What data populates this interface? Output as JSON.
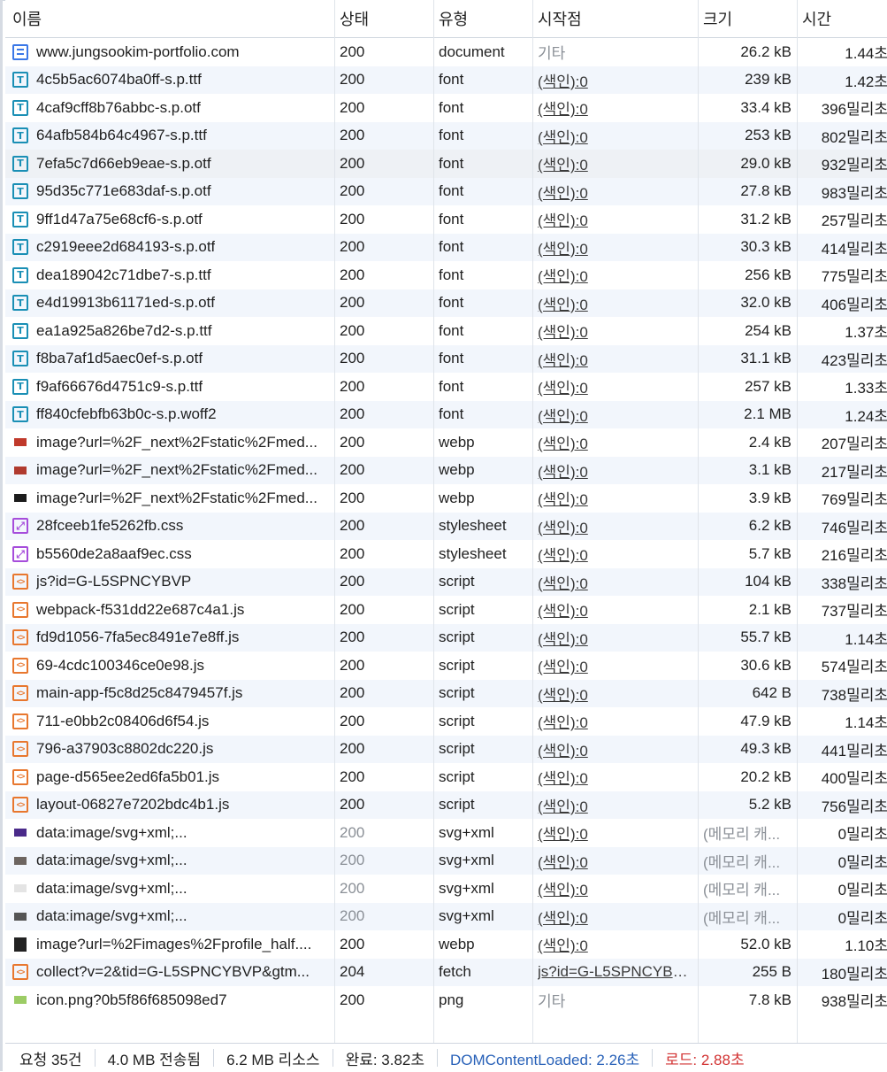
{
  "columns": {
    "name": "이름",
    "status": "상태",
    "type": "유형",
    "initiator": "시작점",
    "size": "크기",
    "time": "시간"
  },
  "rows": [
    {
      "name": "www.jungsookim-portfolio.com",
      "status": "200",
      "type": "document",
      "initiator": "기타",
      "size": "26.2 kB",
      "time": "1.44초",
      "icon": "document-icon"
    },
    {
      "name": "4c5b5ac6074ba0ff-s.p.ttf",
      "status": "200",
      "type": "font",
      "initiator": "(색인):0",
      "size": "239 kB",
      "time": "1.42초",
      "icon": "font-icon"
    },
    {
      "name": "4caf9cff8b76abbc-s.p.otf",
      "status": "200",
      "type": "font",
      "initiator": "(색인):0",
      "size": "33.4 kB",
      "time": "396밀리초",
      "icon": "font-icon"
    },
    {
      "name": "64afb584b64c4967-s.p.ttf",
      "status": "200",
      "type": "font",
      "initiator": "(색인):0",
      "size": "253 kB",
      "time": "802밀리초",
      "icon": "font-icon"
    },
    {
      "name": "7efa5c7d66eb9eae-s.p.otf",
      "status": "200",
      "type": "font",
      "initiator": "(색인):0",
      "size": "29.0 kB",
      "time": "932밀리초",
      "icon": "font-icon"
    },
    {
      "name": "95d35c771e683daf-s.p.otf",
      "status": "200",
      "type": "font",
      "initiator": "(색인):0",
      "size": "27.8 kB",
      "time": "983밀리초",
      "icon": "font-icon"
    },
    {
      "name": "9ff1d47a75e68cf6-s.p.otf",
      "status": "200",
      "type": "font",
      "initiator": "(색인):0",
      "size": "31.2 kB",
      "time": "257밀리초",
      "icon": "font-icon"
    },
    {
      "name": "c2919eee2d684193-s.p.otf",
      "status": "200",
      "type": "font",
      "initiator": "(색인):0",
      "size": "30.3 kB",
      "time": "414밀리초",
      "icon": "font-icon"
    },
    {
      "name": "dea189042c71dbe7-s.p.ttf",
      "status": "200",
      "type": "font",
      "initiator": "(색인):0",
      "size": "256 kB",
      "time": "775밀리초",
      "icon": "font-icon"
    },
    {
      "name": "e4d19913b61171ed-s.p.otf",
      "status": "200",
      "type": "font",
      "initiator": "(색인):0",
      "size": "32.0 kB",
      "time": "406밀리초",
      "icon": "font-icon"
    },
    {
      "name": "ea1a925a826be7d2-s.p.ttf",
      "status": "200",
      "type": "font",
      "initiator": "(색인):0",
      "size": "254 kB",
      "time": "1.37초",
      "icon": "font-icon"
    },
    {
      "name": "f8ba7af1d5aec0ef-s.p.otf",
      "status": "200",
      "type": "font",
      "initiator": "(색인):0",
      "size": "31.1 kB",
      "time": "423밀리초",
      "icon": "font-icon"
    },
    {
      "name": "f9af66676d4751c9-s.p.ttf",
      "status": "200",
      "type": "font",
      "initiator": "(색인):0",
      "size": "257 kB",
      "time": "1.33초",
      "icon": "font-icon"
    },
    {
      "name": "ff840cfebfb63b0c-s.p.woff2",
      "status": "200",
      "type": "font",
      "initiator": "(색인):0",
      "size": "2.1 MB",
      "time": "1.24초",
      "icon": "font-icon"
    },
    {
      "name": "image?url=%2F_next%2Fstatic%2Fmed...",
      "status": "200",
      "type": "webp",
      "initiator": "(색인):0",
      "size": "2.4 kB",
      "time": "207밀리초",
      "icon": "image-thumbnail-icon",
      "thumb": "#c0392b"
    },
    {
      "name": "image?url=%2F_next%2Fstatic%2Fmed...",
      "status": "200",
      "type": "webp",
      "initiator": "(색인):0",
      "size": "3.1 kB",
      "time": "217밀리초",
      "icon": "image-thumbnail-icon",
      "thumb": "#b03a2e"
    },
    {
      "name": "image?url=%2F_next%2Fstatic%2Fmed...",
      "status": "200",
      "type": "webp",
      "initiator": "(색인):0",
      "size": "3.9 kB",
      "time": "769밀리초",
      "icon": "image-thumbnail-icon",
      "thumb": "#1c1c1c"
    },
    {
      "name": "28fceeb1fe5262fb.css",
      "status": "200",
      "type": "stylesheet",
      "initiator": "(색인):0",
      "size": "6.2 kB",
      "time": "746밀리초",
      "icon": "stylesheet-icon"
    },
    {
      "name": "b5560de2a8aaf9ec.css",
      "status": "200",
      "type": "stylesheet",
      "initiator": "(색인):0",
      "size": "5.7 kB",
      "time": "216밀리초",
      "icon": "stylesheet-icon"
    },
    {
      "name": "js?id=G-L5SPNCYBVP",
      "status": "200",
      "type": "script",
      "initiator": "(색인):0",
      "size": "104 kB",
      "time": "338밀리초",
      "icon": "script-icon"
    },
    {
      "name": "webpack-f531dd22e687c4a1.js",
      "status": "200",
      "type": "script",
      "initiator": "(색인):0",
      "size": "2.1 kB",
      "time": "737밀리초",
      "icon": "script-icon"
    },
    {
      "name": "fd9d1056-7fa5ec8491e7e8ff.js",
      "status": "200",
      "type": "script",
      "initiator": "(색인):0",
      "size": "55.7 kB",
      "time": "1.14초",
      "icon": "script-icon"
    },
    {
      "name": "69-4cdc100346ce0e98.js",
      "status": "200",
      "type": "script",
      "initiator": "(색인):0",
      "size": "30.6 kB",
      "time": "574밀리초",
      "icon": "script-icon"
    },
    {
      "name": "main-app-f5c8d25c8479457f.js",
      "status": "200",
      "type": "script",
      "initiator": "(색인):0",
      "size": "642 B",
      "time": "738밀리초",
      "icon": "script-icon"
    },
    {
      "name": "711-e0bb2c08406d6f54.js",
      "status": "200",
      "type": "script",
      "initiator": "(색인):0",
      "size": "47.9 kB",
      "time": "1.14초",
      "icon": "script-icon"
    },
    {
      "name": "796-a37903c8802dc220.js",
      "status": "200",
      "type": "script",
      "initiator": "(색인):0",
      "size": "49.3 kB",
      "time": "441밀리초",
      "icon": "script-icon"
    },
    {
      "name": "page-d565ee2ed6fa5b01.js",
      "status": "200",
      "type": "script",
      "initiator": "(색인):0",
      "size": "20.2 kB",
      "time": "400밀리초",
      "icon": "script-icon"
    },
    {
      "name": "layout-06827e7202bdc4b1.js",
      "status": "200",
      "type": "script",
      "initiator": "(색인):0",
      "size": "5.2 kB",
      "time": "756밀리초",
      "icon": "script-icon"
    },
    {
      "name": "data:image/svg+xml;...",
      "status": "200",
      "type": "svg+xml",
      "initiator": "(색인):0",
      "size": "(메모리 캐...",
      "time": "0밀리초",
      "icon": "image-thumbnail-icon",
      "thumb": "#4a2a8a",
      "muted": true
    },
    {
      "name": "data:image/svg+xml;...",
      "status": "200",
      "type": "svg+xml",
      "initiator": "(색인):0",
      "size": "(메모리 캐...",
      "time": "0밀리초",
      "icon": "image-thumbnail-icon",
      "thumb": "#6d6560",
      "muted": true
    },
    {
      "name": "data:image/svg+xml;...",
      "status": "200",
      "type": "svg+xml",
      "initiator": "(색인):0",
      "size": "(메모리 캐...",
      "time": "0밀리초",
      "icon": "image-thumbnail-icon",
      "thumb": "#e4e4e4",
      "muted": true
    },
    {
      "name": "data:image/svg+xml;...",
      "status": "200",
      "type": "svg+xml",
      "initiator": "(색인):0",
      "size": "(메모리 캐...",
      "time": "0밀리초",
      "icon": "image-thumbnail-icon",
      "thumb": "#555555",
      "muted": true
    },
    {
      "name": "image?url=%2Fimages%2Fprofile_half....",
      "status": "200",
      "type": "webp",
      "initiator": "(색인):0",
      "size": "52.0 kB",
      "time": "1.10초",
      "icon": "image-thumbnail-icon",
      "thumb": "#222222"
    },
    {
      "name": "collect?v=2&tid=G-L5SPNCYBVP&gtm...",
      "status": "204",
      "type": "fetch",
      "initiator": "js?id=G-L5SPNCYBVP:...",
      "size": "255 B",
      "time": "180밀리초",
      "icon": "script-icon"
    },
    {
      "name": "icon.png?0b5f86f685098ed7",
      "status": "200",
      "type": "png",
      "initiator": "기타",
      "size": "7.8 kB",
      "time": "938밀리초",
      "icon": "image-thumbnail-icon",
      "thumb": "#9ccc65"
    }
  ],
  "footer": {
    "requests": "요청 35건",
    "transferred": "4.0 MB 전송됨",
    "resources": "6.2 MB 리소스",
    "finish": "완료: 3.82초",
    "dom_content_loaded": "DOMContentLoaded: 2.26초",
    "load": "로드: 2.88초"
  },
  "colors": {
    "dcl": "#2861b8",
    "load": "#d23232",
    "font_icon": "#1a8fb5",
    "script_icon": "#e8772e",
    "css_icon": "#a64ddb",
    "doc_icon": "#3b78e7"
  }
}
